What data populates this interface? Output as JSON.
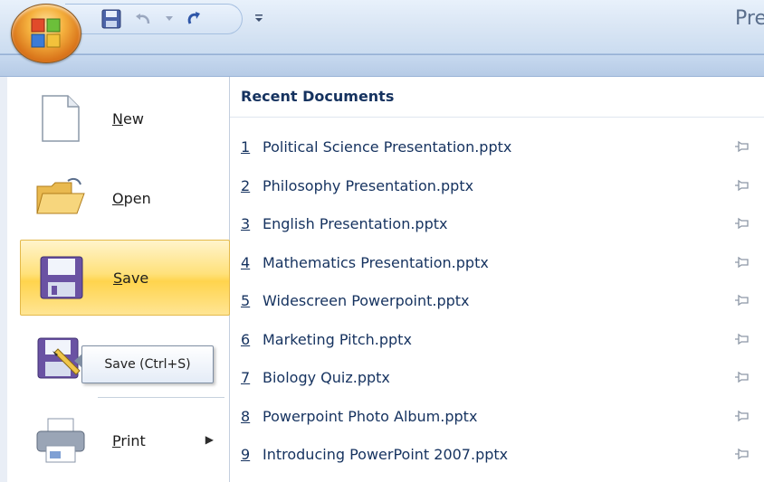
{
  "window": {
    "title_visible": "Pre",
    "quick_access": [
      {
        "name": "save-icon"
      },
      {
        "name": "undo-icon"
      },
      {
        "name": "undo-dropdown-icon"
      },
      {
        "name": "redo-icon"
      }
    ],
    "customize_icon": "customize-qat-icon"
  },
  "office_button": {
    "icon": "office-logo-icon"
  },
  "commands": [
    {
      "key": "new",
      "label": "New",
      "underline": "N",
      "rest": "ew",
      "icon": "new-document-icon",
      "state": "normal"
    },
    {
      "key": "open",
      "label": "Open",
      "underline": "O",
      "rest": "pen",
      "icon": "open-folder-icon",
      "state": "normal"
    },
    {
      "key": "save",
      "label": "Save",
      "underline": "S",
      "rest": "ave",
      "icon": "save-disk-icon",
      "state": "hover"
    },
    {
      "key": "save-as",
      "label": "",
      "underline": "",
      "rest": "",
      "icon": "save-as-icon",
      "state": "normal"
    },
    {
      "key": "print",
      "label": "Print",
      "underline": "P",
      "rest": "rint",
      "icon": "printer-icon",
      "state": "normal",
      "has_submenu": true
    }
  ],
  "tooltip": {
    "text": "Save (Ctrl+S)"
  },
  "recent": {
    "header": "Recent Documents",
    "items": [
      {
        "num": "1",
        "name": "Political Science Presentation.pptx"
      },
      {
        "num": "2",
        "name": "Philosophy Presentation.pptx"
      },
      {
        "num": "3",
        "name": "English Presentation.pptx"
      },
      {
        "num": "4",
        "name": "Mathematics Presentation.pptx"
      },
      {
        "num": "5",
        "name": "Widescreen Powerpoint.pptx"
      },
      {
        "num": "6",
        "name": "Marketing Pitch.pptx"
      },
      {
        "num": "7",
        "name": "Biology Quiz.pptx"
      },
      {
        "num": "8",
        "name": "Powerpoint Photo Album.pptx"
      },
      {
        "num": "9",
        "name": "Introducing PowerPoint 2007.pptx"
      }
    ]
  },
  "colors": {
    "accent": "#ffd44d",
    "text": "#15325f",
    "frame": "#cbdcf0"
  }
}
